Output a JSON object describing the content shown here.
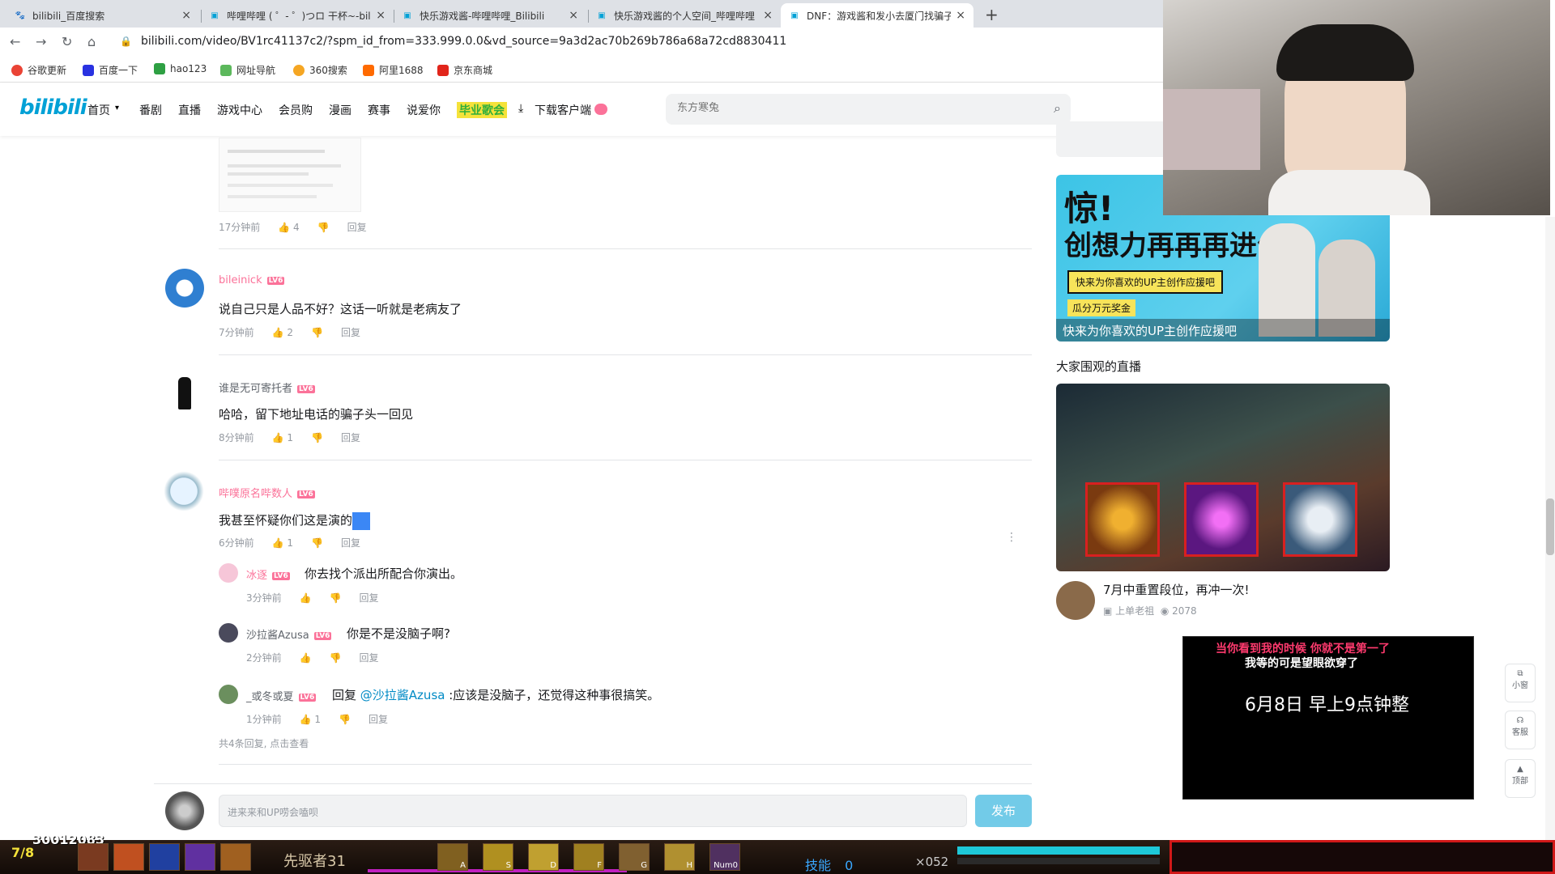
{
  "browser": {
    "tabs": [
      {
        "title": "bilibili_百度搜索",
        "icon": "paw-icon"
      },
      {
        "title": "哔哩哔哩 ( ゜- ゜)つロ 干杯~-bili",
        "icon": "tv-icon"
      },
      {
        "title": "快乐游戏酱-哔哩哔哩_Bilibili",
        "icon": "tv-icon"
      },
      {
        "title": "快乐游戏酱的个人空间_哔哩哔哩",
        "icon": "tv-icon"
      },
      {
        "title": "DNF：游戏酱和发小去厦门找骗子",
        "icon": "tv-icon"
      }
    ],
    "new_tab": "+",
    "url": "bilibili.com/video/BV1rc41137c2/?spm_id_from=333.999.0.0&vd_source=9a3d2ac70b269b786a68a72cd8830411",
    "bookmarks": [
      "谷歌更新",
      "百度一下",
      "hao123",
      "网址导航",
      "360搜索",
      "阿里1688",
      "京东商城"
    ]
  },
  "header": {
    "logo": "bilibili",
    "nav": [
      "首页",
      "番剧",
      "直播",
      "游戏中心",
      "会员购",
      "漫画",
      "赛事",
      "说爱你",
      "毕业歌会",
      "下载客户端"
    ],
    "search_placeholder": "东方寒兔"
  },
  "comments": {
    "top_partial": {
      "time": "17分钟前",
      "likes": "4",
      "reply": "回复"
    },
    "items": [
      {
        "user": "bileinick",
        "level": "LV6",
        "text": "说自己只是人品不好？这话一听就是老病友了",
        "time": "7分钟前",
        "likes": "2",
        "reply": "回复"
      },
      {
        "user": "谁是无可寄托者",
        "level": "LV6",
        "text": "哈哈，留下地址电话的骗子头一回见",
        "time": "8分钟前",
        "likes": "1",
        "reply": "回复"
      },
      {
        "user": "哔噗原名哔数人",
        "level": "LV6",
        "text": "我甚至怀疑你们这是演的",
        "time": "6分钟前",
        "likes": "1",
        "reply": "回复"
      }
    ],
    "replies": [
      {
        "user": "冰逐",
        "level": "LV6",
        "text": "你去找个派出所配合你演出。",
        "time": "3分钟前",
        "likes": "",
        "reply": "回复"
      },
      {
        "user": "沙拉酱Azusa",
        "level": "LV6",
        "text": "你是不是没脑子啊?",
        "time": "2分钟前",
        "likes": "",
        "reply": "回复"
      },
      {
        "user": "_或冬或夏",
        "level": "LV6",
        "prefix": "回复",
        "mention": "@沙拉酱Azusa",
        "text": ":应该是没脑子，还觉得这种事很搞笑。",
        "time": "1分钟前",
        "likes": "1",
        "reply": "回复"
      }
    ],
    "more_replies": "共4条回复, 点击查看",
    "input_placeholder": "进来来和UP唠会嗑呗",
    "publish": "发布"
  },
  "sidebar": {
    "ad_banner": {
      "line1": "惊!",
      "line2": "创想力再再再进化",
      "sub": "快来为你喜欢的UP主创作应援吧",
      "bonus": "瓜分万元奖金",
      "caption": "快来为你喜欢的UP主创作应援吧"
    },
    "live_section_title": "大家围观的直播",
    "live_item": {
      "title": "7月中重置段位，再冲一次!",
      "author": "上单老祖",
      "views": "2078"
    },
    "promo_box": {
      "top": "当你看到我的时候 你就不是第一了",
      "sub": "我等的可是望眼欲穿了",
      "main": "6月8日 早上9点钟整"
    }
  },
  "float_buttons": [
    "小窗",
    "客服",
    "顶部"
  ],
  "game": {
    "counter": "30012083",
    "level": "7/8",
    "title": "先驱者31",
    "skill_label": "技能",
    "skill_value": "0",
    "potion": "×052",
    "keys": [
      "A",
      "S",
      "D",
      "F",
      "G",
      "H",
      "Num0"
    ]
  },
  "colors": {
    "bili_blue": "#00a1d6",
    "bili_pink": "#fb7299"
  }
}
